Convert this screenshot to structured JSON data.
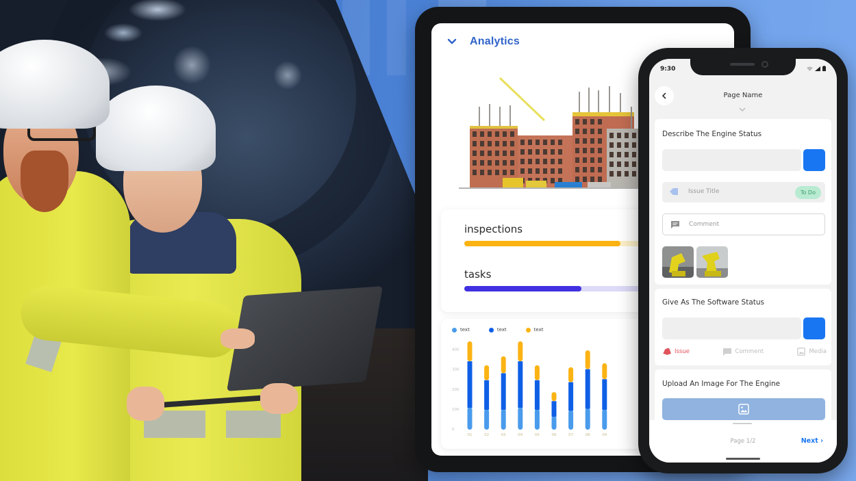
{
  "tablet": {
    "header": {
      "chevron_icon": "chevron-down-icon",
      "title": "Analytics"
    },
    "hero_image": "construction-building-illustration",
    "progress": [
      {
        "label": "inspections",
        "value": 0.76,
        "color": "#fbb314",
        "track_color": "#fdf0c8"
      },
      {
        "label": "tasks",
        "value": 0.57,
        "color": "#4030e0",
        "track_color": "#dcdaf7"
      }
    ],
    "chart_legend": [
      {
        "label": "text",
        "color": "#4a9bec"
      },
      {
        "label": "text",
        "color": "#0f5fe6"
      },
      {
        "label": "text",
        "color": "#fbb314"
      }
    ]
  },
  "chart_data": {
    "type": "bar",
    "stacked": true,
    "title": "",
    "xlabel": "",
    "ylabel": "",
    "categories": [
      "01",
      "02",
      "03",
      "04",
      "05",
      "06",
      "07",
      "08",
      "09"
    ],
    "yticks": [
      "0",
      "100",
      "200",
      "300",
      "400"
    ],
    "ylim": [
      0,
      450
    ],
    "grid": false,
    "legend_position": "top-left",
    "series": [
      {
        "name": "text",
        "color": "#4a9bec",
        "values": [
          110,
          100,
          100,
          110,
          100,
          65,
          95,
          105,
          100
        ]
      },
      {
        "name": "text",
        "color": "#0f5fe6",
        "values": [
          230,
          145,
          180,
          230,
          145,
          75,
          140,
          195,
          150
        ]
      },
      {
        "name": "text",
        "color": "#fbb314",
        "values": [
          100,
          75,
          85,
          100,
          75,
          45,
          75,
          95,
          80
        ]
      }
    ]
  },
  "phone": {
    "status_bar": {
      "time": "9:30"
    },
    "header": {
      "back_icon": "chevron-left-icon",
      "title": "Page Name"
    },
    "section1": {
      "title": "Describe The Engine Status",
      "issue_placeholder": "Issue Title",
      "issue_status": "To Do",
      "comment_placeholder": "Comment",
      "thumbnails": [
        "yellow-robot-arm-1",
        "yellow-robot-arm-2"
      ]
    },
    "section2": {
      "title": "Give As The Software Status",
      "tabs": [
        {
          "label": "Issue",
          "icon": "tag-icon",
          "active": true
        },
        {
          "label": "Comment",
          "icon": "comment-icon",
          "active": false
        },
        {
          "label": "Media",
          "icon": "image-icon",
          "active": false
        }
      ]
    },
    "section3": {
      "title": "Upload An Image For The Engine",
      "upload_icon": "image-icon"
    },
    "footer": {
      "page_indicator": "Page 1/2",
      "next_label": "Next"
    }
  }
}
